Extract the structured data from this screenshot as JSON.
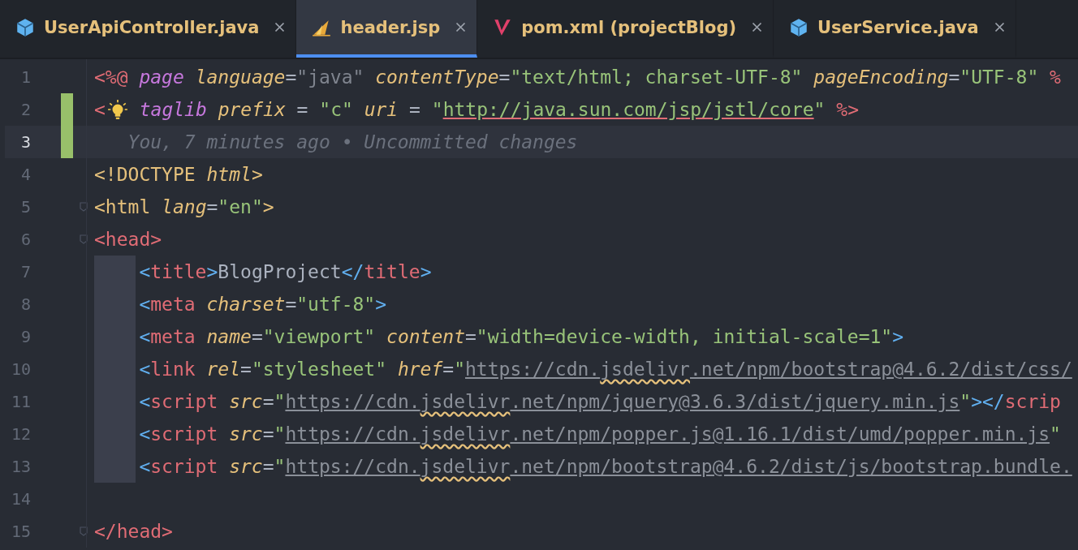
{
  "tabs": [
    {
      "label": "UserApiController.java",
      "kind": "java",
      "selected": false
    },
    {
      "label": "header.jsp",
      "kind": "jsp",
      "selected": true
    },
    {
      "label": "pom.xml (projectBlog)",
      "kind": "maven",
      "selected": false
    },
    {
      "label": "UserService.java",
      "kind": "java",
      "selected": false
    }
  ],
  "editor": {
    "lines": [
      {
        "number": "1",
        "changed": false,
        "current": false,
        "fold": false,
        "indented": false,
        "bulb": false,
        "tokens": [
          {
            "text": "<%@",
            "kind": "delim"
          },
          {
            "text": " page",
            "kind": "directive"
          },
          {
            "text": " language",
            "kind": "attr"
          },
          {
            "text": "=",
            "kind": "op"
          },
          {
            "text": "\"java\"",
            "kind": "dim"
          },
          {
            "text": " contentType",
            "kind": "attr"
          },
          {
            "text": "=",
            "kind": "op"
          },
          {
            "text": "\"text/html; charset-UTF-8\"",
            "kind": "string"
          },
          {
            "text": " pageEncoding",
            "kind": "attr"
          },
          {
            "text": "=",
            "kind": "op"
          },
          {
            "text": "\"UTF-8\"",
            "kind": "string"
          },
          {
            "text": " %",
            "kind": "delim"
          }
        ]
      },
      {
        "number": "2",
        "changed": true,
        "current": false,
        "fold": false,
        "indented": false,
        "bulb": true,
        "tokens": [
          {
            "text": "<",
            "kind": "delim"
          },
          {
            "text": "taglib",
            "kind": "directive"
          },
          {
            "text": " prefix",
            "kind": "attr"
          },
          {
            "text": " = ",
            "kind": "op"
          },
          {
            "text": "\"c\"",
            "kind": "string"
          },
          {
            "text": " uri",
            "kind": "attr"
          },
          {
            "text": " = ",
            "kind": "op"
          },
          {
            "text": "\"",
            "kind": "string"
          },
          {
            "text": "http://java.sun.com/jsp/jstl/core",
            "kind": "uri"
          },
          {
            "text": "\"",
            "kind": "string"
          },
          {
            "text": " %>",
            "kind": "delim"
          }
        ]
      },
      {
        "number": "3",
        "changed": true,
        "current": true,
        "fold": false,
        "indented": false,
        "bulb": false,
        "blame": "You, 7 minutes ago • Uncommitted changes"
      },
      {
        "number": "4",
        "changed": false,
        "current": false,
        "fold": false,
        "indented": false,
        "bulb": false,
        "tokens": [
          {
            "text": "<!DOCTYPE",
            "kind": "doctype"
          },
          {
            "text": " html",
            "kind": "attr"
          },
          {
            "text": ">",
            "kind": "doctype"
          }
        ]
      },
      {
        "number": "5",
        "changed": false,
        "current": false,
        "fold": true,
        "indented": false,
        "bulb": false,
        "tokens": [
          {
            "text": "<html",
            "kind": "doctype"
          },
          {
            "text": " lang",
            "kind": "attr"
          },
          {
            "text": "=",
            "kind": "op"
          },
          {
            "text": "\"en\"",
            "kind": "string"
          },
          {
            "text": ">",
            "kind": "doctype"
          }
        ]
      },
      {
        "number": "6",
        "changed": false,
        "current": false,
        "fold": true,
        "indented": false,
        "bulb": false,
        "tokens": [
          {
            "text": "<head>",
            "kind": "tag"
          }
        ]
      },
      {
        "number": "7",
        "changed": false,
        "current": false,
        "fold": false,
        "indented": true,
        "bulb": false,
        "tokens": [
          {
            "text": "<",
            "kind": "bracket"
          },
          {
            "text": "title",
            "kind": "tag"
          },
          {
            "text": ">",
            "kind": "bracket"
          },
          {
            "text": "BlogProject",
            "kind": "text"
          },
          {
            "text": "</",
            "kind": "bracket"
          },
          {
            "text": "title",
            "kind": "tag"
          },
          {
            "text": ">",
            "kind": "bracket"
          }
        ]
      },
      {
        "number": "8",
        "changed": false,
        "current": false,
        "fold": false,
        "indented": true,
        "bulb": false,
        "tokens": [
          {
            "text": "<",
            "kind": "bracket"
          },
          {
            "text": "meta",
            "kind": "tag"
          },
          {
            "text": " charset",
            "kind": "attr"
          },
          {
            "text": "=",
            "kind": "op"
          },
          {
            "text": "\"utf-8\"",
            "kind": "string"
          },
          {
            "text": ">",
            "kind": "bracket"
          }
        ]
      },
      {
        "number": "9",
        "changed": false,
        "current": false,
        "fold": false,
        "indented": true,
        "bulb": false,
        "tokens": [
          {
            "text": "<",
            "kind": "bracket"
          },
          {
            "text": "meta",
            "kind": "tag"
          },
          {
            "text": " name",
            "kind": "attr"
          },
          {
            "text": "=",
            "kind": "op"
          },
          {
            "text": "\"viewport\"",
            "kind": "string"
          },
          {
            "text": " content",
            "kind": "attr"
          },
          {
            "text": "=",
            "kind": "op"
          },
          {
            "text": "\"width=device-width, initial-scale=1\"",
            "kind": "string"
          },
          {
            "text": ">",
            "kind": "bracket"
          }
        ]
      },
      {
        "number": "10",
        "changed": false,
        "current": false,
        "fold": false,
        "indented": true,
        "bulb": false,
        "tokens": [
          {
            "text": "<",
            "kind": "bracket"
          },
          {
            "text": "link",
            "kind": "tag"
          },
          {
            "text": " rel",
            "kind": "attr"
          },
          {
            "text": "=",
            "kind": "op"
          },
          {
            "text": "\"stylesheet\"",
            "kind": "string"
          },
          {
            "text": " href",
            "kind": "attr"
          },
          {
            "text": "=",
            "kind": "op"
          },
          {
            "text": "\"",
            "kind": "string"
          },
          {
            "text": "https://cdn.",
            "kind": "link"
          },
          {
            "text": "jsdelivr",
            "kind": "typo"
          },
          {
            "text": ".net/npm/bootstrap@4.6.2/dist/css/",
            "kind": "link"
          }
        ]
      },
      {
        "number": "11",
        "changed": false,
        "current": false,
        "fold": false,
        "indented": true,
        "bulb": false,
        "tokens": [
          {
            "text": "<",
            "kind": "bracket"
          },
          {
            "text": "script",
            "kind": "tag"
          },
          {
            "text": " src",
            "kind": "attr"
          },
          {
            "text": "=",
            "kind": "op"
          },
          {
            "text": "\"",
            "kind": "string"
          },
          {
            "text": "https://cdn.",
            "kind": "link"
          },
          {
            "text": "jsdelivr",
            "kind": "typo"
          },
          {
            "text": ".net/npm/jquery@3.6.3/dist/jquery.min.js",
            "kind": "link"
          },
          {
            "text": "\"",
            "kind": "string"
          },
          {
            "text": "></",
            "kind": "bracket"
          },
          {
            "text": "scrip",
            "kind": "tag"
          }
        ]
      },
      {
        "number": "12",
        "changed": false,
        "current": false,
        "fold": false,
        "indented": true,
        "bulb": false,
        "tokens": [
          {
            "text": "<",
            "kind": "bracket"
          },
          {
            "text": "script",
            "kind": "tag"
          },
          {
            "text": " src",
            "kind": "attr"
          },
          {
            "text": "=",
            "kind": "op"
          },
          {
            "text": "\"",
            "kind": "string"
          },
          {
            "text": "https://cdn.",
            "kind": "link"
          },
          {
            "text": "jsdelivr",
            "kind": "typo"
          },
          {
            "text": ".net/npm/popper.js@1.16.1/dist/umd/popper.min.js",
            "kind": "link"
          },
          {
            "text": "\"",
            "kind": "string"
          }
        ]
      },
      {
        "number": "13",
        "changed": false,
        "current": false,
        "fold": false,
        "indented": true,
        "bulb": false,
        "tokens": [
          {
            "text": "<",
            "kind": "bracket"
          },
          {
            "text": "script",
            "kind": "tag"
          },
          {
            "text": " src",
            "kind": "attr"
          },
          {
            "text": "=",
            "kind": "op"
          },
          {
            "text": "\"",
            "kind": "string"
          },
          {
            "text": "https://cdn.",
            "kind": "link"
          },
          {
            "text": "jsdelivr",
            "kind": "typo"
          },
          {
            "text": ".net/npm/bootstrap@4.6.2/dist/js/bootstrap.bundle.",
            "kind": "link"
          }
        ]
      },
      {
        "number": "14",
        "changed": false,
        "current": false,
        "fold": false,
        "indented": false,
        "bulb": false
      },
      {
        "number": "15",
        "changed": false,
        "current": false,
        "fold": true,
        "indented": false,
        "bulb": false,
        "tokens": [
          {
            "text": "</head>",
            "kind": "tag"
          }
        ]
      }
    ]
  }
}
